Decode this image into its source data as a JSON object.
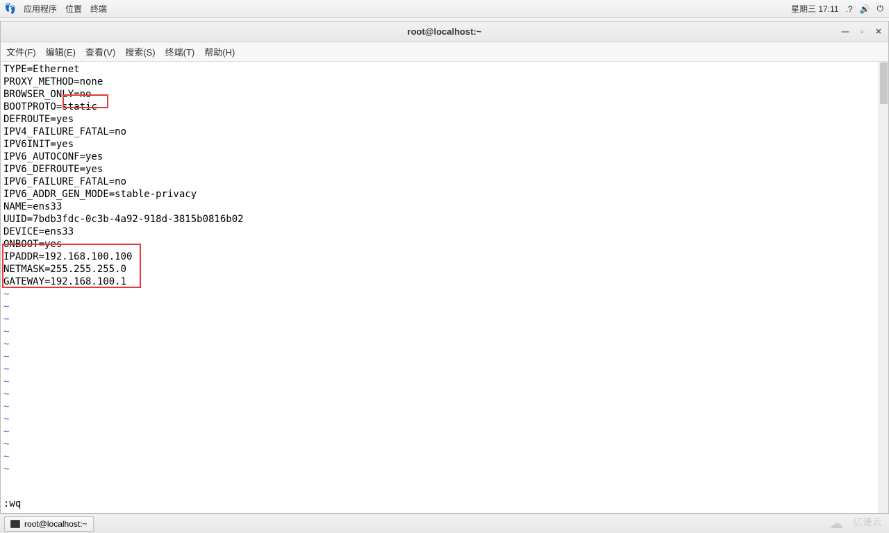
{
  "top_panel": {
    "apps": "应用程序",
    "places": "位置",
    "terminal": "终端",
    "datetime": "星期三 17:11",
    "help_icon": "?",
    "volume_icon": "🔊",
    "power_icon": "⏻"
  },
  "window": {
    "title": "root@localhost:~"
  },
  "menubar": {
    "file": "文件(F)",
    "edit": "编辑(E)",
    "view": "查看(V)",
    "search": "搜索(S)",
    "terminal": "终端(T)",
    "help": "帮助(H)"
  },
  "config": {
    "lines": [
      "TYPE=Ethernet",
      "PROXY_METHOD=none",
      "BROWSER_ONLY=no",
      "BOOTPROTO=static",
      "DEFROUTE=yes",
      "IPV4_FAILURE_FATAL=no",
      "IPV6INIT=yes",
      "IPV6_AUTOCONF=yes",
      "IPV6_DEFROUTE=yes",
      "IPV6_FAILURE_FATAL=no",
      "IPV6_ADDR_GEN_MODE=stable-privacy",
      "NAME=ens33",
      "UUID=7bdb3fdc-0c3b-4a92-918d-3815b0816b02",
      "DEVICE=ens33",
      "ONBOOT=yes",
      "IPADDR=192.168.100.100",
      "NETMASK=255.255.255.0",
      "GATEWAY=192.168.100.1"
    ],
    "tilde": "~",
    "vim_cmd": ":wq"
  },
  "taskbar": {
    "item1": "root@localhost:~"
  },
  "watermark": "亿速云"
}
